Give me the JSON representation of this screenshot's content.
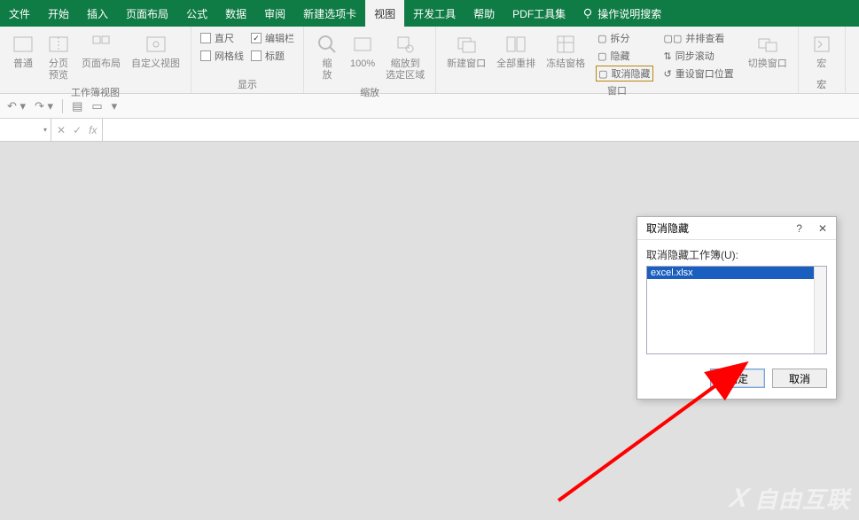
{
  "tabs": {
    "file": "文件",
    "home": "开始",
    "insert": "插入",
    "layout": "页面布局",
    "formula": "公式",
    "data": "数据",
    "review": "审阅",
    "newtab": "新建选项卡",
    "view": "视图",
    "dev": "开发工具",
    "help": "帮助",
    "pdf": "PDF工具集",
    "tellme": "操作说明搜索"
  },
  "ribbon": {
    "views": {
      "normal": "普通",
      "pagebreak": "分页\n预览",
      "pagelayout": "页面布局",
      "custom": "自定义视图",
      "group": "工作簿视图"
    },
    "show": {
      "ruler": "直尺",
      "formulabar": "编辑栏",
      "gridlines": "网格线",
      "headings": "标题",
      "group": "显示"
    },
    "zoom": {
      "zoom": "缩\n放",
      "hundred": "100%",
      "selection": "缩放到\n选定区域",
      "group": "缩放"
    },
    "window": {
      "neww": "新建窗口",
      "arrange": "全部重排",
      "freeze": "冻结窗格",
      "split": "拆分",
      "hide": "隐藏",
      "unhide": "取消隐藏",
      "sidebyside": "并排查看",
      "syncscroll": "同步滚动",
      "resetpos": "重设窗口位置",
      "switch": "切换窗口",
      "group": "窗口"
    },
    "macros": {
      "macros": "宏",
      "group": "宏"
    }
  },
  "dialog": {
    "title": "取消隐藏",
    "label": "取消隐藏工作簿(U):",
    "item": "excel.xlsx",
    "ok": "确定",
    "cancel": "取消",
    "help": "?",
    "close": "✕"
  },
  "watermark": {
    "brand": "自由互联"
  }
}
